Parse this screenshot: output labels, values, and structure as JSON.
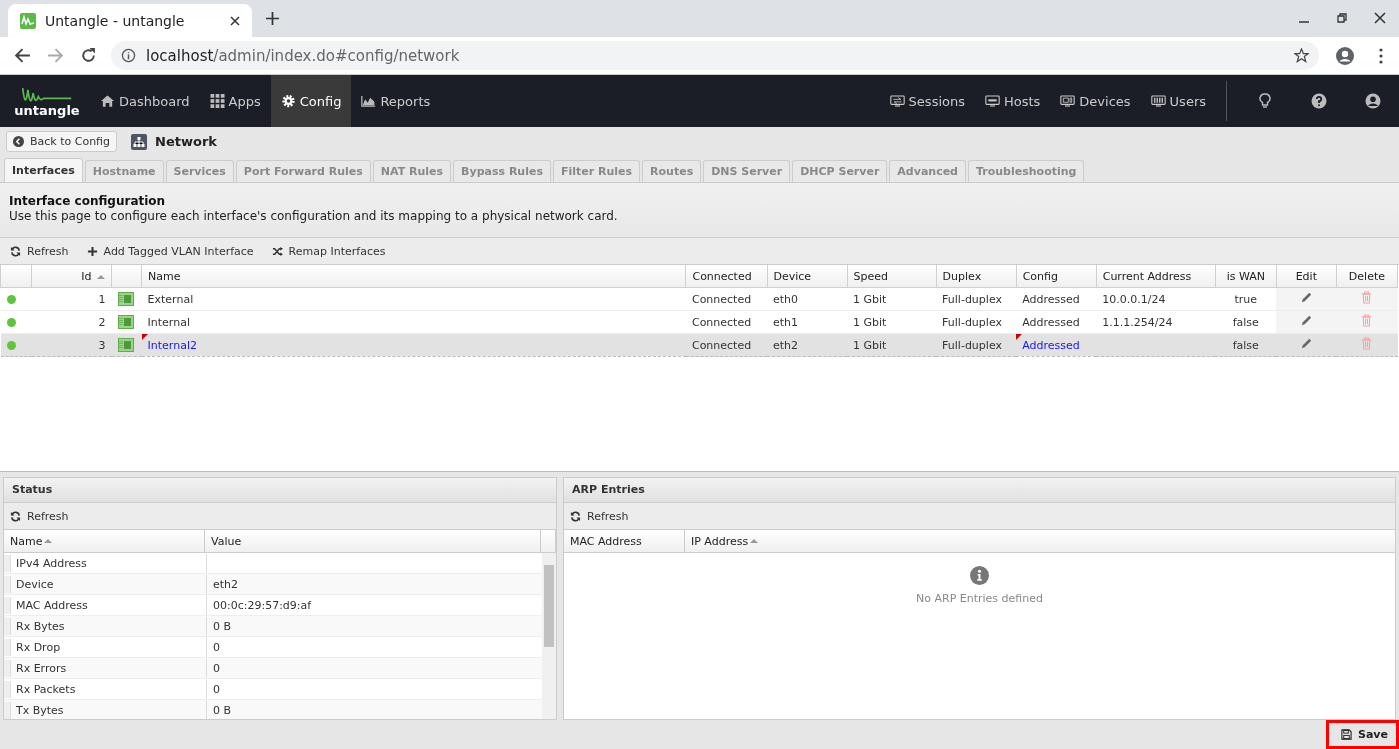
{
  "browser": {
    "tab_title": "Untangle - untangle",
    "url_host": "localhost",
    "url_path": "/admin/index.do#config/network"
  },
  "nav": {
    "logo": "untangle",
    "items": [
      {
        "label": "Dashboard",
        "selected": false
      },
      {
        "label": "Apps",
        "selected": false
      },
      {
        "label": "Config",
        "selected": true
      },
      {
        "label": "Reports",
        "selected": false
      }
    ],
    "right_items": [
      {
        "label": "Sessions"
      },
      {
        "label": "Hosts"
      },
      {
        "label": "Devices"
      },
      {
        "label": "Users"
      }
    ]
  },
  "header": {
    "back_button": "Back to Config",
    "title": "Network"
  },
  "tabs": [
    {
      "label": "Interfaces",
      "selected": true
    },
    {
      "label": "Hostname",
      "selected": false
    },
    {
      "label": "Services",
      "selected": false
    },
    {
      "label": "Port Forward Rules",
      "selected": false
    },
    {
      "label": "NAT Rules",
      "selected": false
    },
    {
      "label": "Bypass Rules",
      "selected": false
    },
    {
      "label": "Filter Rules",
      "selected": false
    },
    {
      "label": "Routes",
      "selected": false
    },
    {
      "label": "DNS Server",
      "selected": false
    },
    {
      "label": "DHCP Server",
      "selected": false
    },
    {
      "label": "Advanced",
      "selected": false
    },
    {
      "label": "Troubleshooting",
      "selected": false
    }
  ],
  "section": {
    "title": "Interface configuration",
    "description": "Use this page to configure each interface's configuration and its mapping to a physical network card."
  },
  "toolbar": [
    "Refresh",
    "Add Tagged VLAN Interface",
    "Remap Interfaces"
  ],
  "interfaces": {
    "columns": [
      "Id",
      "Name",
      "Connected",
      "Device",
      "Speed",
      "Duplex",
      "Config",
      "Current Address",
      "is WAN",
      "Edit",
      "Delete"
    ],
    "rows": [
      {
        "online": true,
        "id": "1",
        "name": "External",
        "connected": "Connected",
        "device": "eth0",
        "speed": "1 Gbit",
        "duplex": "Full-duplex",
        "config": "Addressed",
        "address": "10.0.0.1/24",
        "is_wan": "true",
        "selected": false,
        "modified": false
      },
      {
        "online": true,
        "id": "2",
        "name": "Internal",
        "connected": "Connected",
        "device": "eth1",
        "speed": "1 Gbit",
        "duplex": "Full-duplex",
        "config": "Addressed",
        "address": "1.1.1.254/24",
        "is_wan": "false",
        "selected": false,
        "modified": false
      },
      {
        "online": true,
        "id": "3",
        "name": "Internal2",
        "connected": "Connected",
        "device": "eth2",
        "speed": "1 Gbit",
        "duplex": "Full-duplex",
        "config": "Addressed",
        "address": "",
        "is_wan": "false",
        "selected": true,
        "modified": true
      }
    ]
  },
  "status": {
    "title": "Status",
    "refresh": "Refresh",
    "columns": [
      "Name",
      "Value"
    ],
    "rows": [
      {
        "name": "IPv4 Address",
        "value": ""
      },
      {
        "name": "Device",
        "value": "eth2"
      },
      {
        "name": "MAC Address",
        "value": "00:0c:29:57:d9:af"
      },
      {
        "name": "Rx Bytes",
        "value": "0 B"
      },
      {
        "name": "Rx Drop",
        "value": "0"
      },
      {
        "name": "Rx Errors",
        "value": "0"
      },
      {
        "name": "Rx Packets",
        "value": "0"
      },
      {
        "name": "Tx Bytes",
        "value": "0 B"
      }
    ]
  },
  "arp": {
    "title": "ARP Entries",
    "refresh": "Refresh",
    "columns": [
      "MAC Address",
      "IP Address"
    ],
    "empty_message": "No ARP Entries defined"
  },
  "save": {
    "label": "Save",
    "highlighted": true
  }
}
